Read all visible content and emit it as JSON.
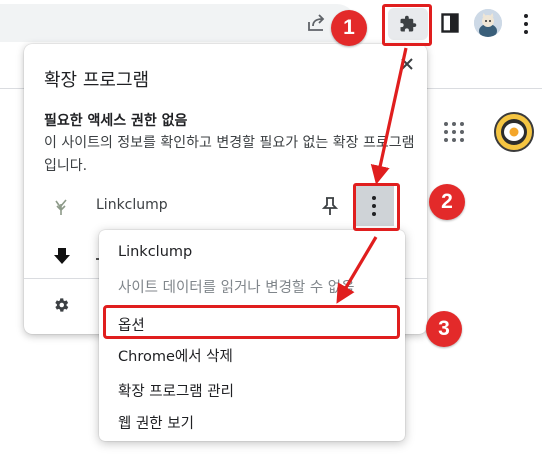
{
  "toolbar": {
    "icons": [
      "share-icon",
      "puzzle-icon",
      "side-panel-icon",
      "profile-avatar",
      "more-vert-icon"
    ]
  },
  "page": {
    "icons": [
      "apps-grid-icon",
      "google-account-avatar"
    ]
  },
  "extensions_popup": {
    "title": "확장 프로그램",
    "close_icon": "close-icon",
    "section_heading": "필요한 액세스 권한 없음",
    "section_desc": "이 사이트의 정보를 확인하고 변경할 필요가 없는 확장 프로그램입니다.",
    "extensions": [
      {
        "name": "Linkclump",
        "icon": "leaf-icon"
      },
      {
        "name": "",
        "icon": "down-arrow-icon"
      }
    ],
    "footer_icon": "gear-icon"
  },
  "context_menu": {
    "items": [
      {
        "label": "Linkclump",
        "enabled": true
      },
      {
        "label": "사이트 데이터를 읽거나 변경할 수 없음",
        "enabled": false
      },
      {
        "label": "옵션",
        "enabled": true
      },
      {
        "label": "Chrome에서 삭제",
        "enabled": true
      },
      {
        "label": "확장 프로그램 관리",
        "enabled": true
      },
      {
        "label": "웹 권한 보기",
        "enabled": true
      }
    ]
  },
  "annotations": {
    "steps": [
      "1",
      "2",
      "3"
    ],
    "color": "#e01e1e"
  }
}
